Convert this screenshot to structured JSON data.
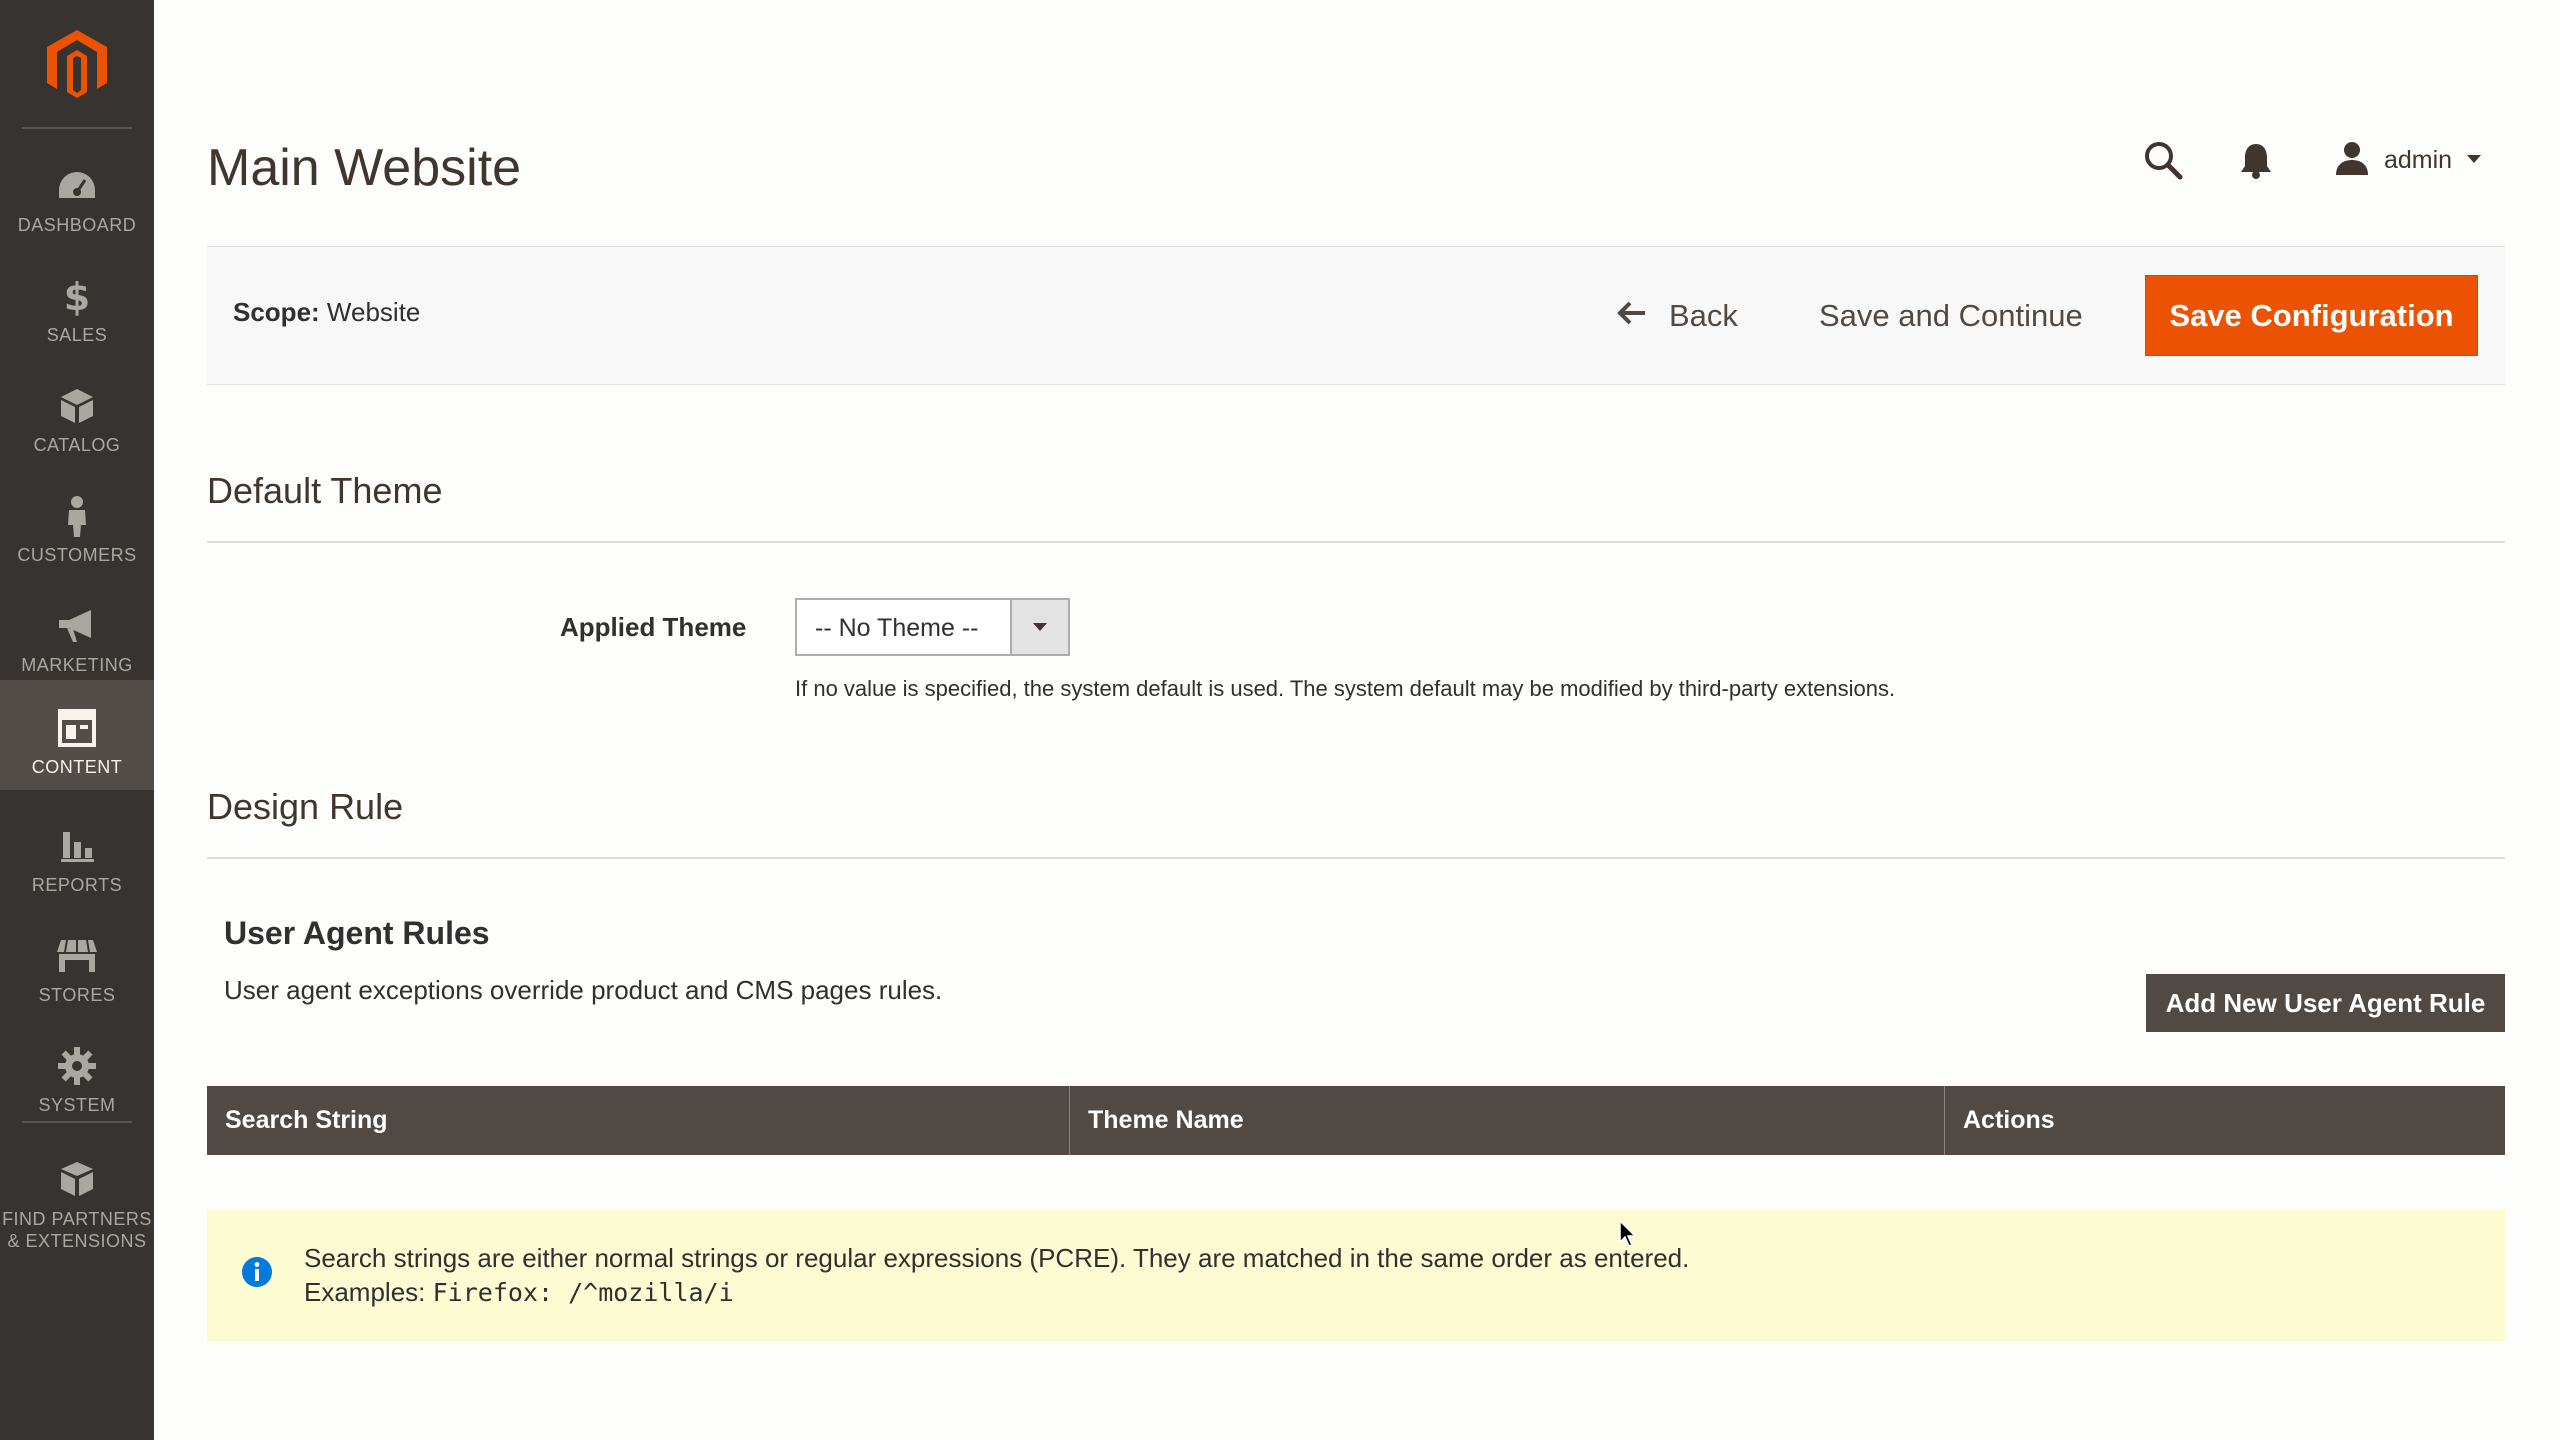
{
  "colors": {
    "sidebar_bg": "#373330",
    "sidebar_active_bg": "#524d49",
    "accent": "#eb5202",
    "dark_button": "#514943",
    "notice_bg": "#fdfbd1",
    "info_icon": "#007bdb"
  },
  "sidebar": {
    "logo_icon": "magento-logo-icon",
    "items": [
      {
        "label": "DASHBOARD",
        "icon": "dashboard-icon"
      },
      {
        "label": "SALES",
        "icon": "dollar-icon"
      },
      {
        "label": "CATALOG",
        "icon": "box-icon"
      },
      {
        "label": "CUSTOMERS",
        "icon": "person-icon"
      },
      {
        "label": "MARKETING",
        "icon": "megaphone-icon"
      },
      {
        "label": "CONTENT",
        "icon": "layout-icon",
        "active": true
      },
      {
        "label": "REPORTS",
        "icon": "bar-chart-icon"
      },
      {
        "label": "STORES",
        "icon": "store-icon"
      },
      {
        "label": "SYSTEM",
        "icon": "gear-icon"
      },
      {
        "label": "FIND PARTNERS & EXTENSIONS",
        "icon": "cubes-icon"
      }
    ]
  },
  "header": {
    "title": "Main Website",
    "user": "admin"
  },
  "actionbar": {
    "scope_label": "Scope:",
    "scope_value": "Website",
    "back_label": "Back",
    "save_continue_label": "Save and Continue",
    "save_config_label": "Save Configuration"
  },
  "default_theme": {
    "title": "Default Theme",
    "field_label": "Applied Theme",
    "selected": "-- No Theme --",
    "note": "If no value is specified, the system default is used. The system default may be modified by third-party extensions."
  },
  "design_rule": {
    "title": "Design Rule",
    "subtitle": "User Agent Rules",
    "note": "User agent exceptions override product and CMS pages rules.",
    "add_button": "Add New User Agent Rule",
    "columns": [
      "Search String",
      "Theme Name",
      "Actions"
    ],
    "notice_line1": "Search strings are either normal strings or regular expressions (PCRE). They are matched in the same order as entered.",
    "notice_examples_label": "Examples:",
    "notice_examples_code": "Firefox: /^mozilla/i"
  }
}
